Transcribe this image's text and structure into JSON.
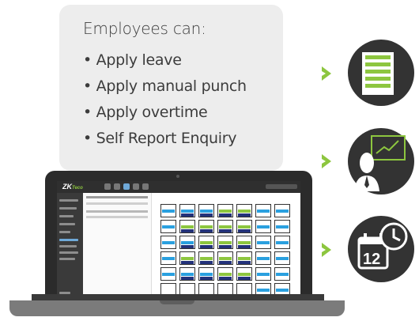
{
  "card": {
    "title": "Employees can:",
    "bullets": [
      "Apply leave",
      "Apply manual punch",
      "Apply overtime",
      "Self Report Enquiry"
    ]
  },
  "laptop": {
    "logo_main": "ZK",
    "logo_accent": "Teco"
  },
  "icons": {
    "item1": "list-document-icon",
    "item2": "presentation-person-icon",
    "item3": "calendar-clock-icon"
  },
  "colors": {
    "accent_green": "#8dc63f",
    "circle_dark": "#333333",
    "card_bg": "#ededed",
    "cal_blue": "#2aa0df",
    "cal_navy": "#23327a"
  }
}
